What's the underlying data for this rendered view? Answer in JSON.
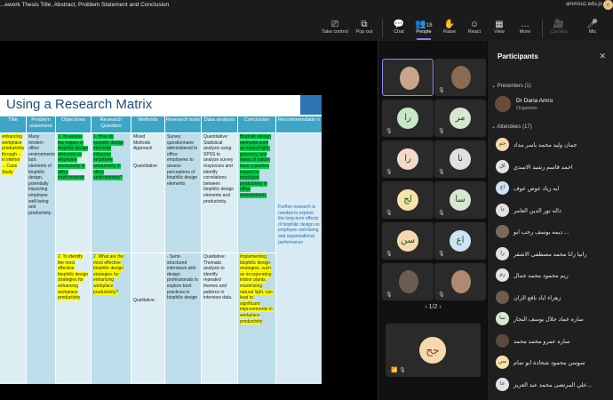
{
  "window": {
    "title": "...ework Thesis Title, Abstract, Problem Statement and Conclusion",
    "account": "ammouz.edu.jo",
    "avatar_initials": "ج"
  },
  "toolbar": {
    "take_control": "Take control",
    "pop_out": "Pop out",
    "chat": "Chat",
    "people": "People",
    "people_count": "18",
    "raise": "Raise",
    "react": "React",
    "view": "View",
    "more": "More",
    "camera": "Camera",
    "mic": "Mic"
  },
  "slide": {
    "title": "Using a Research Matrix",
    "headers": [
      "Title",
      "Problem statement",
      "Objectives",
      "Research Question",
      "Methods",
      "Research tools",
      "Data analysis",
      "Conclusion",
      "Recommendatio n"
    ],
    "row1": {
      "title": "enhancing workplace productivity through ... in interior ... Case Study",
      "problem": "Many modern office environments lack elements of biophilic design, potentially impacting employee well-being and productivity.",
      "obj": "1. To assess the impact of biophilic design elements on employee productivity in office environments",
      "rq": "1. How do biophilic design elements influence employee productivity in office environments?",
      "methods": "Mixed Methods Approach",
      "methods2": "Quantitative:",
      "tools": "Survey questionnaire administered to office employees to assess perceptions of biophilic design elements",
      "analysis": "Quantitative: Statistical analysis using SPSS to analyze survey responses and identify correlations between biophilic design elements and productivity.",
      "conclusion": "Biophilic design elements such as natural light, greenery, and views of nature have a positive impact on employee productivity in office environments",
      "rec": "Further research is needed to explore the long-term effects of biophilic design on employee well-being and organizational performance"
    },
    "row2": {
      "obj": "2. To identify the most effective biophilic design strategies for enhancing workplace productivity",
      "rq": "2. What are the most effective biophilic design strategies for enhancing workplace productivity?",
      "methods": "Qualitative:",
      "tools": "- Semi-structured interviews with design professionals to explore best practices in biophilic design",
      "analysis": "Qualitative: Thematic analysis to identify repeated themes and patterns in interview data.",
      "conclusion": "Implementing biophilic design strategies, such as incorporating indoor plants, maximizing natural light, can lead to significant improvements in workplace productivity"
    }
  },
  "gallery": {
    "tiles": [
      {
        "initials": "",
        "type": "photo"
      },
      {
        "initials": "",
        "type": "photo2"
      },
      {
        "initials": "را"
      },
      {
        "initials": "مر"
      },
      {
        "initials": "را"
      },
      {
        "initials": "نا"
      },
      {
        "initials": "لج"
      },
      {
        "initials": "سا"
      },
      {
        "initials": "سن"
      },
      {
        "initials": "اع"
      },
      {
        "initials": "",
        "type": "photo"
      },
      {
        "initials": "",
        "type": "photo3"
      }
    ],
    "pager": "1/2",
    "big_initials": "جح"
  },
  "participants": {
    "header": "Participants",
    "presenters_label": "Presenters (1)",
    "presenter_name": "Dr Dana Amro",
    "presenter_role": "Organizer",
    "attendees_label": "Attendees (17)",
    "attendees": [
      {
        "name": "جمان وليد محمد ياسر مداد",
        "initials": "جم",
        "color": "#f6d9ae"
      },
      {
        "name": "احمد قاسم رشيد الاسدي",
        "initials": "اق",
        "color": "#e3e3e3"
      },
      {
        "name": "ايه زياد عوض عوف",
        "initials": "اع",
        "color": "#cfe3f6"
      },
      {
        "name": "داله نور الدين العامر",
        "initials": "دا",
        "color": "#e3e3e3"
      },
      {
        "name": "ديمه يوسف رجب ابو ...",
        "initials": "",
        "color": "#7a6a5c"
      },
      {
        "name": "رانيا رانا محمد مصطفى الاشقر",
        "initials": "را",
        "color": "#e3e3e3"
      },
      {
        "name": "ريم محمود محمد جمال",
        "initials": "رم",
        "color": "#e3e3e3"
      },
      {
        "name": "زهراء اياد نافع الزان",
        "initials": "",
        "color": "#6d5c50"
      },
      {
        "name": "ساره عماد جلال يوسف النجار",
        "initials": "سا",
        "color": "#d7e8d2"
      },
      {
        "name": "ساره عمرو محمد محمد",
        "initials": "",
        "color": "#5a4a40"
      },
      {
        "name": "سوسن محمود شحادة ابو تمام",
        "initials": "سن",
        "color": "#f6e3a8"
      },
      {
        "name": "علي المرتضى محمد عبد العزيز...",
        "initials": "عا",
        "color": "#e3e3e3"
      }
    ]
  }
}
